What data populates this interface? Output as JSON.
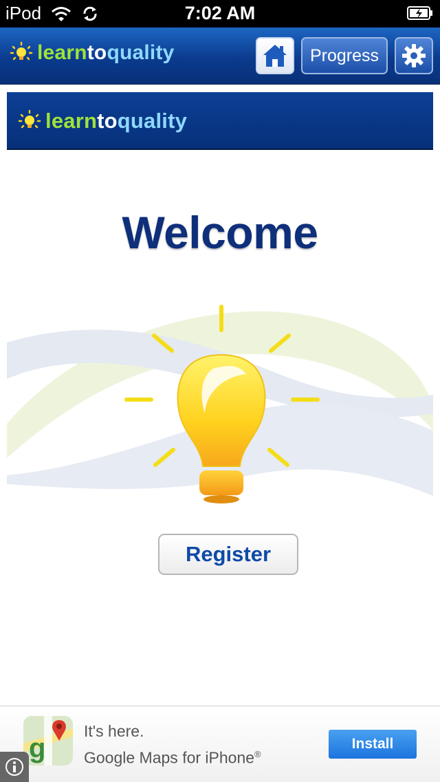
{
  "status_bar": {
    "carrier": "iPod",
    "time": "7:02 AM"
  },
  "header": {
    "logo": {
      "part1": "learn",
      "part2": "to",
      "part3": "quality"
    },
    "progress_label": "Progress"
  },
  "banner": {
    "logo": {
      "part1": "learn",
      "part2": "to",
      "part3": "quality"
    }
  },
  "main": {
    "title": "Welcome",
    "register_label": "Register"
  },
  "ad": {
    "line1": "It's here.",
    "line2": "Google Maps for iPhone",
    "registered_mark": "®",
    "install_label": "Install"
  },
  "colors": {
    "nav_blue": "#0b3b8e",
    "title_navy": "#0e2f7a",
    "logo_green": "#9fe23a",
    "logo_cyan": "#8fd8ff",
    "install_blue": "#2a86e6"
  }
}
